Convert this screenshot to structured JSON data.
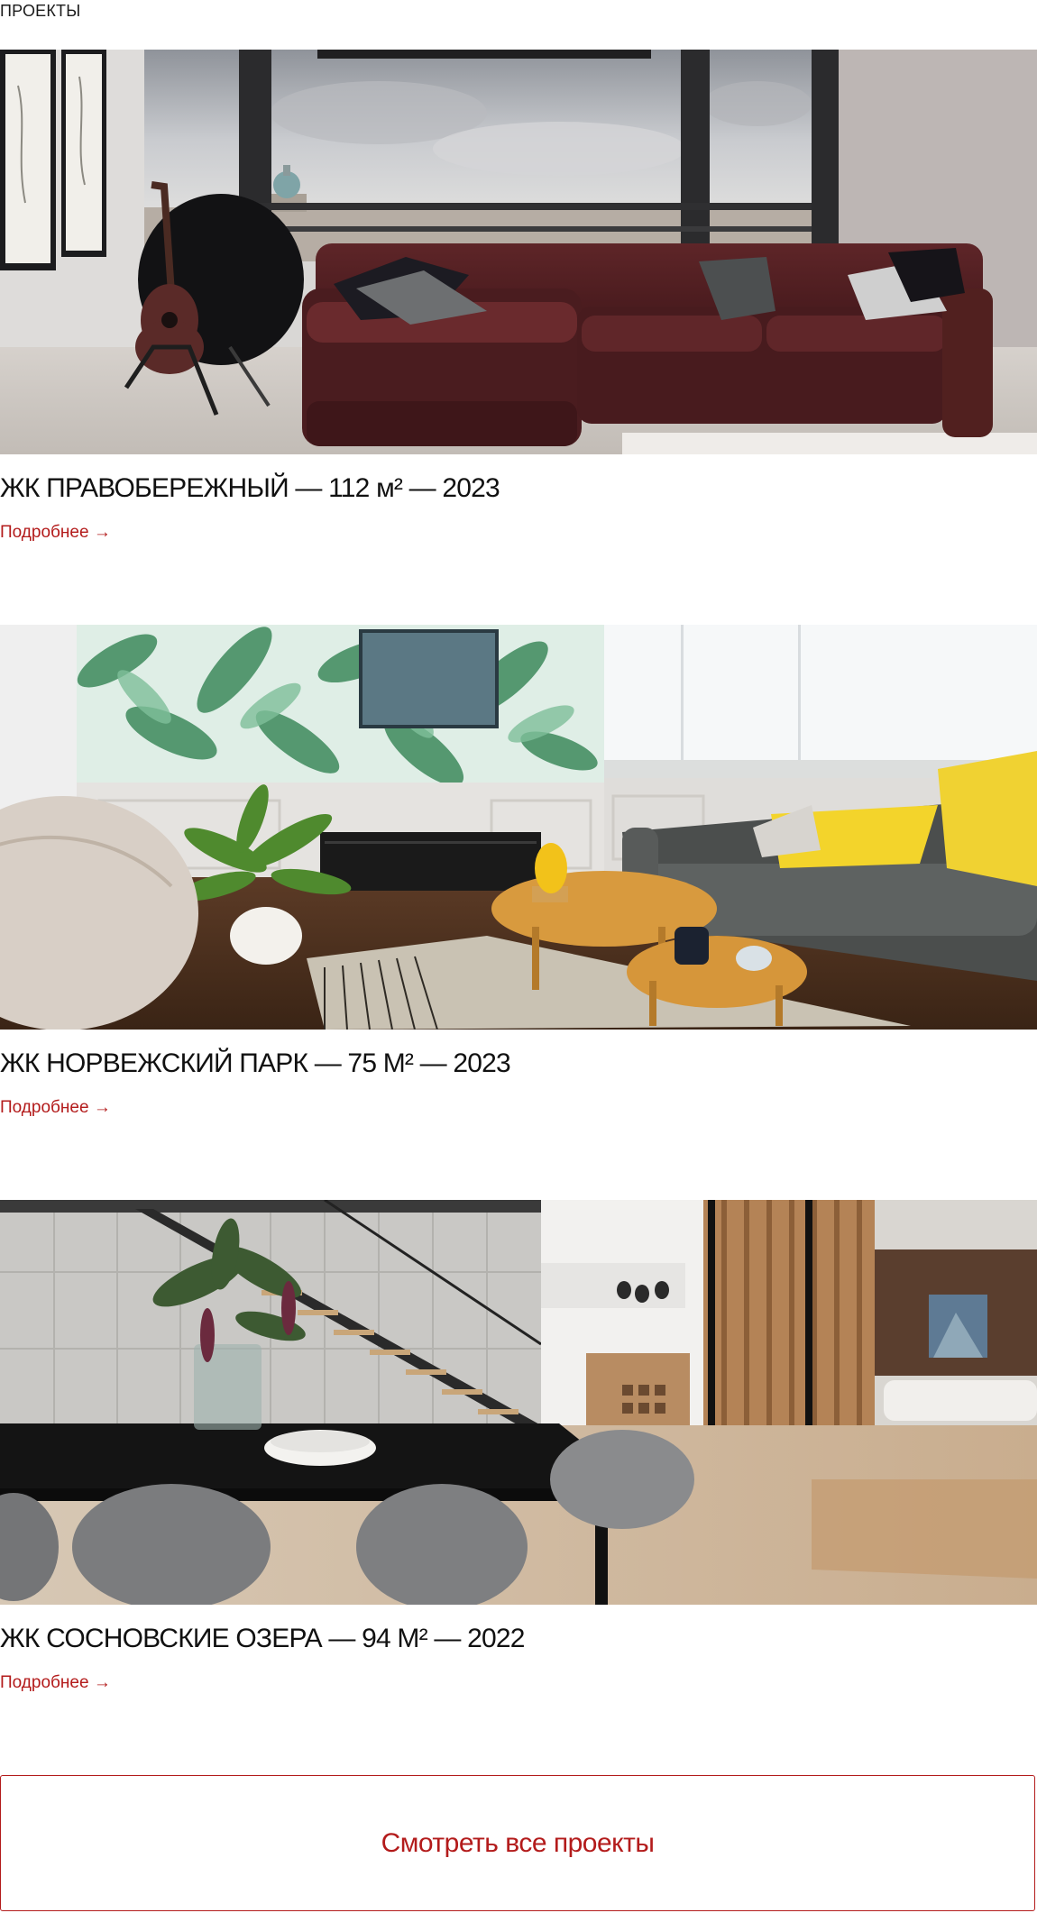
{
  "section": {
    "label": "ПРОЕКТЫ"
  },
  "colors": {
    "accent": "#b31b1b",
    "text": "#111111"
  },
  "projects": [
    {
      "title": "ЖК ПРАВОБЕРЕЖНЫЙ — 112 м² — 2023",
      "link_label": "Подробнее →",
      "photo_alt": "living room with burgundy sofa"
    },
    {
      "title": "ЖК НОРВЕЖСКИЙ ПАРК — 75 М² — 2023",
      "link_label": "Подробнее →",
      "photo_alt": "living room with tropical leaf wallpaper"
    },
    {
      "title": "ЖК СОСНОВСКИЕ ОЗЕРА — 94 М² — 2022",
      "link_label": "Подробнее →",
      "photo_alt": "dining area with black table and staircase"
    }
  ],
  "cta": {
    "label": "Смотреть все проекты"
  }
}
